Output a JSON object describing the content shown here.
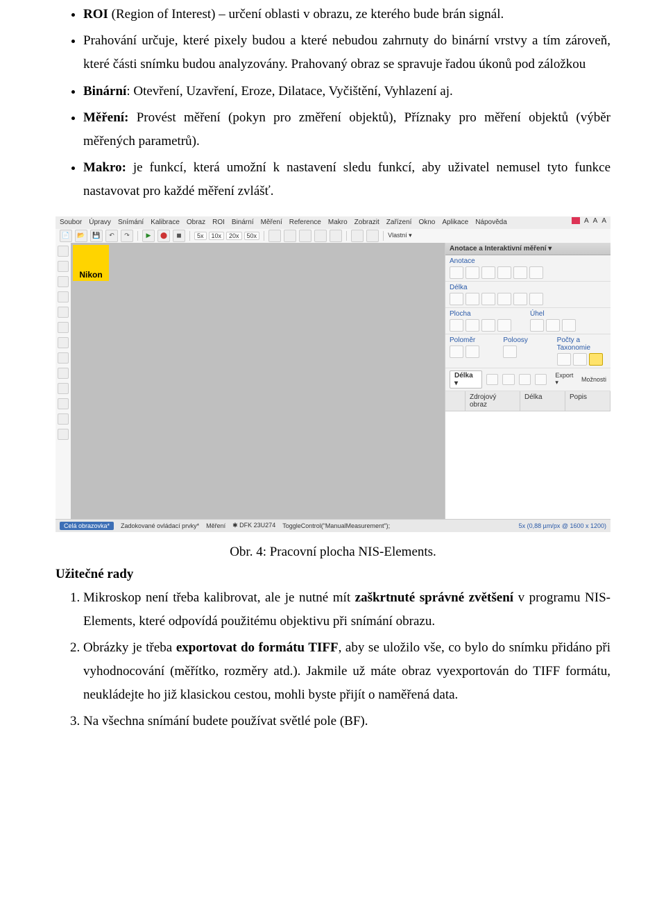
{
  "bullets": [
    {
      "b": "ROI",
      "rest": " (Region of Interest) – určení oblasti v obrazu, ze kterého bude brán signál."
    },
    {
      "plain": "Prahování určuje, které pixely budou a které nebudou zahrnuty do binární vrstvy a tím zároveň, které části snímku budou analyzovány. Prahovaný obraz se spravuje řadou úkonů pod záložkou"
    },
    {
      "b": "Binární",
      "rest": ": Otevření, Uzavření, Eroze, Dilatace, Vyčištění, Vyhlazení aj."
    },
    {
      "b": "Měření:",
      "rest": " Provést měření (pokyn pro změření objektů), Příznaky pro měření objektů (výběr měřených parametrů)."
    },
    {
      "b": "Makro:",
      "rest": " je funkcí, která umožní k nastavení sledu funkcí, aby uživatel nemusel tyto funkce nastavovat pro každé měření zvlášť."
    }
  ],
  "caption": "Obr. 4: Pracovní plocha NIS-Elements.",
  "section": "Užitečné rady",
  "tips": [
    {
      "pre": "Mikroskop není třeba kalibrovat, ale je nutné mít ",
      "b": "zaškrtnuté správné zvětšení",
      "post": " v programu NIS-Elements, které odpovídá použitému objektivu při snímání obrazu."
    },
    {
      "pre": "Obrázky je třeba ",
      "b": "exportovat do formátu TIFF",
      "post": ", aby se uložilo vše, co bylo do snímku přidáno při vyhodnocování (měřítko, rozměry atd.). Jakmile už máte obraz vyexportován do TIFF formátu, neukládejte ho již klasickou cestou, mohli byste přijít o naměřená data."
    },
    {
      "pre": "Na všechna snímání budete používat světlé pole (BF).",
      "b": "",
      "post": ""
    }
  ],
  "app": {
    "menus": [
      "Soubor",
      "Úpravy",
      "Snímání",
      "Kalibrace",
      "Obraz",
      "ROI",
      "Binární",
      "Měření",
      "Reference",
      "Makro",
      "Zobrazit",
      "Zařízení",
      "Okno",
      "Aplikace",
      "Nápověda"
    ],
    "zoom": {
      "pre": "5x",
      "items": [
        "10x",
        "20x",
        "50x"
      ]
    },
    "vlastni": "Vlastní ▾",
    "tbA": [
      "A",
      "A",
      "A"
    ],
    "logo": "Nikon",
    "panel": {
      "title": "Anotace a Interaktivní měření ▾",
      "secs": [
        "Anotace",
        "Délka",
        "Plocha",
        "Úhel",
        "Poloměr",
        "Poloosy",
        "Počty a Taxonomie"
      ],
      "row": {
        "sel": "Délka  ▾",
        "export": "Export ▾",
        "more": "Možnosti"
      },
      "cols": [
        "",
        "Zdrojový obraz",
        "Délka",
        "Popis"
      ]
    },
    "status": {
      "left": "Celá obrazovka*",
      "tabs": [
        "Zadokované ovládací prvky*",
        "Měření"
      ],
      "dev": "✱ DFK 23U274",
      "cmd": "ToggleControl(\"ManualMeasurement\");",
      "right": "5x (0,88 µm/px @ 1600 x 1200)"
    }
  }
}
